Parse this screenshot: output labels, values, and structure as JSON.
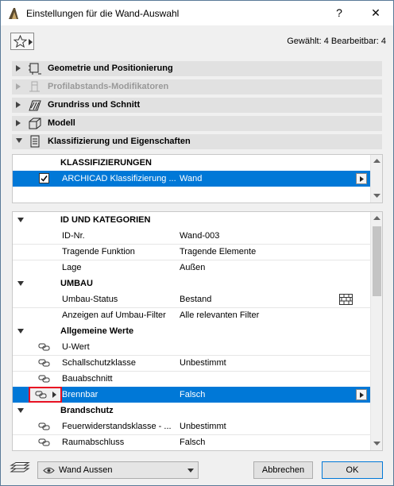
{
  "window": {
    "title": "Einstellungen für die Wand-Auswahl",
    "help_label": "?",
    "close_label": "✕"
  },
  "header": {
    "selection_info": "Gewählt: 4 Bearbeitbar: 4"
  },
  "sections": [
    {
      "label": "Geometrie und Positionierung",
      "icon": "geometry-icon",
      "expanded": false,
      "disabled": false
    },
    {
      "label": "Profilabstands-Modifikatoren",
      "icon": "profile-offset-icon",
      "expanded": false,
      "disabled": true
    },
    {
      "label": "Grundriss und Schnitt",
      "icon": "floor-plan-icon",
      "expanded": false,
      "disabled": false
    },
    {
      "label": "Modell",
      "icon": "model-icon",
      "expanded": false,
      "disabled": false
    },
    {
      "label": "Klassifizierung und Eigenschaften",
      "icon": "classification-icon",
      "expanded": true,
      "disabled": false
    }
  ],
  "classifications": {
    "header": "KLASSIFIZIERUNGEN",
    "rows": [
      {
        "name": "ARCHICAD Klassifizierung ...",
        "value": "Wand",
        "checked": true,
        "selected": true
      }
    ]
  },
  "properties": {
    "groups": [
      {
        "title": "ID UND KATEGORIEN",
        "rows": [
          {
            "name": "ID-Nr.",
            "value": "Wand-003"
          },
          {
            "name": "Tragende Funktion",
            "value": "Tragende Elemente"
          },
          {
            "name": "Lage",
            "value": "Außen"
          }
        ]
      },
      {
        "title": "UMBAU",
        "rows": [
          {
            "name": "Umbau-Status",
            "value": "Bestand",
            "icon": "brick-wall-icon"
          },
          {
            "name": "Anzeigen auf Umbau-Filter",
            "value": "Alle relevanten Filter"
          }
        ]
      },
      {
        "title": "Allgemeine Werte",
        "rows": [
          {
            "name": "U-Wert",
            "value": "",
            "linked": true
          },
          {
            "name": "Schallschutzklasse",
            "value": "Unbestimmt",
            "linked": true
          },
          {
            "name": "Bauabschnitt",
            "value": "",
            "linked": true
          },
          {
            "name": "Brennbar",
            "value": "Falsch",
            "linked": true,
            "selected": true
          }
        ]
      },
      {
        "title": "Brandschutz",
        "rows": [
          {
            "name": "Feuerwiderstandsklasse - ...",
            "value": "Unbestimmt",
            "linked": true
          },
          {
            "name": "Raumabschluss",
            "value": "Falsch",
            "linked": true
          }
        ]
      }
    ]
  },
  "footer": {
    "layer_value": "Wand Aussen",
    "cancel_label": "Abbrechen",
    "ok_label": "OK"
  },
  "colors": {
    "selection": "#0078d7",
    "highlight_box": "#e81123",
    "ok_border": "#0078d7"
  }
}
